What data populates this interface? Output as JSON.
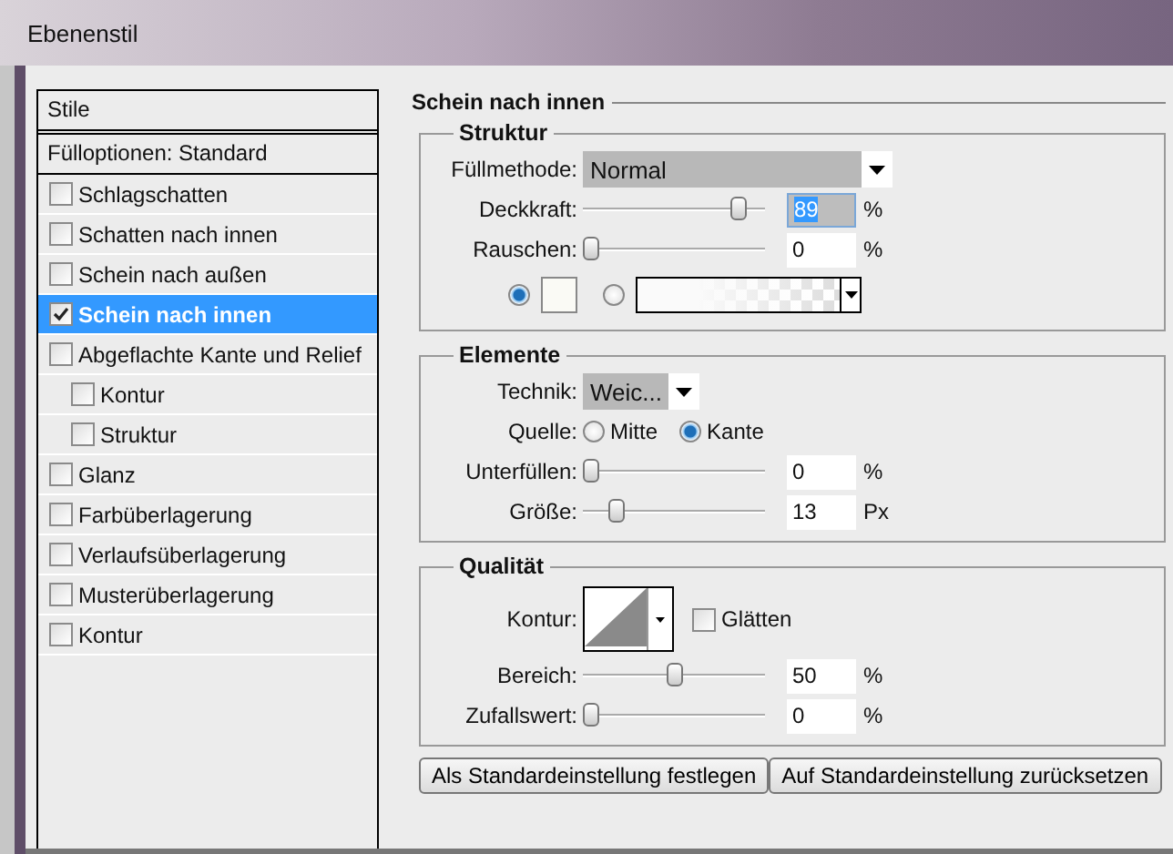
{
  "window": {
    "title": "Ebenenstil"
  },
  "styles_list": {
    "header": "Stile",
    "fill_options": "Fülloptionen: Standard",
    "items": [
      {
        "label": "Schlagschatten",
        "checked": false,
        "selected": false
      },
      {
        "label": "Schatten nach innen",
        "checked": false,
        "selected": false
      },
      {
        "label": "Schein nach außen",
        "checked": false,
        "selected": false
      },
      {
        "label": "Schein nach innen",
        "checked": true,
        "selected": true
      },
      {
        "label": "Abgeflachte Kante und Relief",
        "checked": false,
        "selected": false,
        "children": [
          {
            "label": "Kontur",
            "checked": false,
            "selected": false
          },
          {
            "label": "Struktur",
            "checked": false,
            "selected": false
          }
        ]
      },
      {
        "label": "Glanz",
        "checked": false,
        "selected": false
      },
      {
        "label": "Farbüberlagerung",
        "checked": false,
        "selected": false
      },
      {
        "label": "Verlaufsüberlagerung",
        "checked": false,
        "selected": false
      },
      {
        "label": "Musterüberlagerung",
        "checked": false,
        "selected": false
      },
      {
        "label": "Kontur",
        "checked": false,
        "selected": false
      }
    ]
  },
  "panel": {
    "title": "Schein nach innen",
    "structure": {
      "title": "Struktur",
      "blend_mode": {
        "label": "Füllmethode:",
        "value": "Normal"
      },
      "sliders": [
        {
          "label": "Deckkraft:",
          "level": 0.89,
          "value": "89",
          "unit": "%",
          "focused": true
        },
        {
          "label": "Rauschen:",
          "level": 0,
          "value": "0",
          "unit": "%",
          "focused": false
        }
      ],
      "fill": [
        {
          "kind": "color",
          "selected": true
        },
        {
          "kind": "gradient",
          "selected": false
        }
      ]
    },
    "elements": {
      "title": "Elemente",
      "technique": {
        "label": "Technik:",
        "value": "Weic..."
      },
      "source": {
        "label": "Quelle:",
        "options": [
          {
            "label": "Mitte",
            "selected": false
          },
          {
            "label": "Kante",
            "selected": true
          }
        ]
      },
      "sliders": [
        {
          "label": "Unterfüllen:",
          "level": 0,
          "value": "0",
          "unit": "%",
          "focused": false
        },
        {
          "label": "Größe:",
          "level": 0.15,
          "value": "13",
          "unit": "Px",
          "focused": false
        }
      ]
    },
    "quality": {
      "title": "Qualität",
      "contour": {
        "label": "Kontur:"
      },
      "smooth": {
        "label": "Glätten",
        "checked": false
      },
      "sliders": [
        {
          "label": "Bereich:",
          "level": 0.5,
          "value": "50",
          "unit": "%",
          "focused": false
        },
        {
          "label": "Zufallswert:",
          "level": 0,
          "value": "0",
          "unit": "%",
          "focused": false
        }
      ]
    }
  },
  "buttons": [
    "Als Standardeinstellung festlegen",
    "Auf Standardeinstellung zurücksetzen"
  ]
}
